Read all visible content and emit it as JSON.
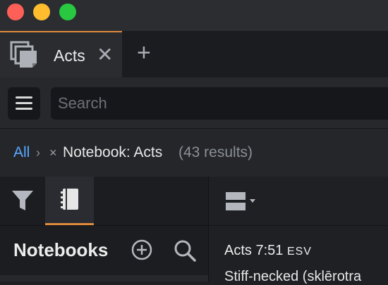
{
  "window": {
    "traffic_lights": [
      "close",
      "minimize",
      "zoom"
    ],
    "colors": {
      "close": "#fe5f57",
      "minimize": "#febc2e",
      "zoom": "#28c840"
    }
  },
  "tabs": [
    {
      "label": "Acts",
      "icon": "documents-stack-icon",
      "active": true
    }
  ],
  "tab_bar": {
    "close_glyph": "✕",
    "new_tab_glyph": "+"
  },
  "search": {
    "placeholder": "Search",
    "value": ""
  },
  "breadcrumb": {
    "all_label": "All",
    "separator": "›",
    "remove_glyph": "×",
    "filter_label": "Notebook: Acts",
    "count_label": "(43 results)"
  },
  "left_panel": {
    "tools": [
      {
        "name": "filter-icon",
        "active": false
      },
      {
        "name": "notebook-icon",
        "active": true
      }
    ],
    "title": "Notebooks",
    "actions": [
      "add-circle-icon",
      "search-icon"
    ]
  },
  "right_panel": {
    "layout_icon": "layout-dropdown-icon",
    "verse_ref": "Acts 7:51",
    "version": "ESV",
    "verse_text_partial": "Stiff-necked (sklērotra"
  },
  "accent_color": "#e08a3c",
  "link_color": "#5aa9ff"
}
